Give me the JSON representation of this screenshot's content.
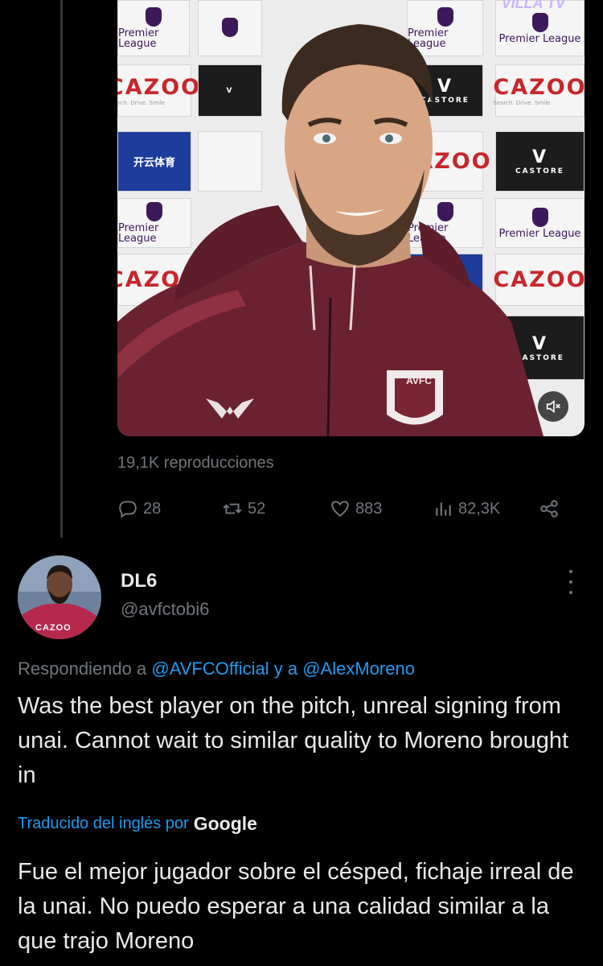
{
  "video": {
    "overlay_brand": "VILLA TV",
    "sponsor_boards": {
      "premier_league": "Premier League",
      "cazoo": "CAZOO",
      "cazoo_tagline": "Search. Drive. Smile",
      "castore": "CASTORE",
      "kaiyun": "开云体育"
    },
    "crest_text": "AVFC",
    "mute_icon": "volume-mute-icon"
  },
  "stats": {
    "views": "19,1K reproducciones",
    "replies": "28",
    "reposts": "52",
    "likes": "883",
    "analytics": "82,3K"
  },
  "reply": {
    "avatar_text": "CAZOO",
    "display_name": "DL6",
    "handle": "@avfctobi6",
    "replying_prefix": "Respondiendo a",
    "replying_to_1": "@AVFCOfficial",
    "replying_connector": "y a",
    "replying_to_2": "@AlexMoreno",
    "text": "Was the best player on the pitch, unreal signing from unai. Cannot wait to similar quality to Moreno brought in",
    "translated_label": "Traducido del inglés por",
    "translated_provider": "Google",
    "translation": "Fue el mejor jugador sobre el césped, fichaje irreal de la unai. No puedo esperar a una calidad similar a la que trajo Moreno"
  },
  "colors": {
    "background": "#000000",
    "link": "#1d9bf0",
    "secondary_text": "#71767b",
    "primary_text": "#e7e9ea",
    "hoodie": "#6b2230"
  }
}
